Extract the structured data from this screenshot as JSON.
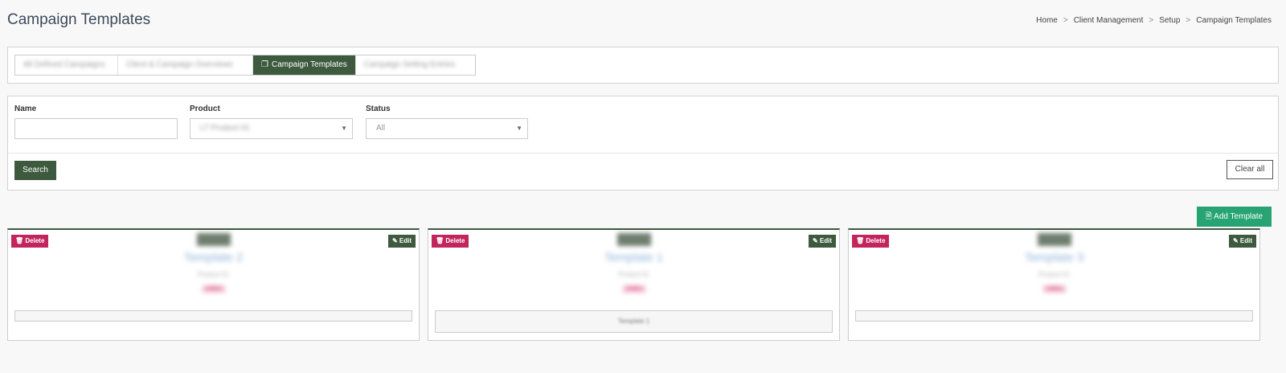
{
  "page": {
    "title": "Campaign Templates",
    "breadcrumb": [
      "Home",
      "Client Management",
      "Setup",
      "Campaign Templates"
    ],
    "breadcrumb_separator": ">"
  },
  "tabs": [
    {
      "label": "All Defined Campaigns",
      "active": false
    },
    {
      "label": "Client & Campaign Overviews",
      "active": false
    },
    {
      "label": "Campaign Templates",
      "active": true
    },
    {
      "label": "Campaign Setting Entries",
      "active": false
    }
  ],
  "filters": {
    "name_label": "Name",
    "name_value": "",
    "product_label": "Product",
    "product_value": "LT Product 01",
    "status_label": "Status",
    "status_value": "All",
    "search_label": "Search",
    "clear_label": "Clear all"
  },
  "add_template_label": "Add Template",
  "cards": [
    {
      "name": "Template 2",
      "product": "Product 01",
      "badge": "Active",
      "footer": "",
      "delete": "Delete",
      "edit": "Edit"
    },
    {
      "name": "Template 1",
      "product": "Product 01",
      "badge": "Active",
      "footer": "Template 1",
      "delete": "Delete",
      "edit": "Edit"
    },
    {
      "name": "Template 3",
      "product": "Product 01",
      "badge": "Active",
      "footer": "",
      "delete": "Delete",
      "edit": "Edit"
    }
  ],
  "colors": {
    "primary_dark_green": "#3d5a3e",
    "add_green": "#27a374",
    "delete_pink": "#c2255c"
  }
}
